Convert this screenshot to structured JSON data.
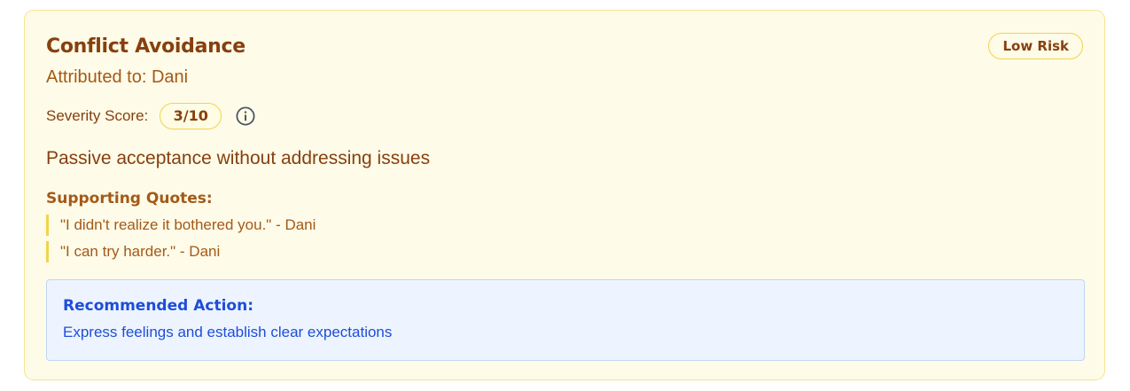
{
  "card": {
    "title": "Conflict Avoidance",
    "attributed_to": "Attributed to: Dani",
    "risk_label": "Low Risk",
    "severity": {
      "label": "Severity Score:",
      "value": "3/10",
      "info_icon": "info-circle-icon"
    },
    "description": "Passive acceptance without addressing issues",
    "quotes": {
      "heading": "Supporting Quotes:",
      "items": [
        "\"I didn't realize it bothered you.\" - Dani",
        "\"I can try harder.\" - Dani"
      ]
    },
    "recommended_action": {
      "heading": "Recommended Action:",
      "text": "Express feelings and establish clear expectations"
    }
  },
  "colors": {
    "card_background": "#fefbe8",
    "card_border": "#f7e48f",
    "title_text": "#86400f",
    "accent_yellow": "#f3d34a",
    "action_background": "#eef4ff",
    "action_text": "#1d4ed8"
  }
}
